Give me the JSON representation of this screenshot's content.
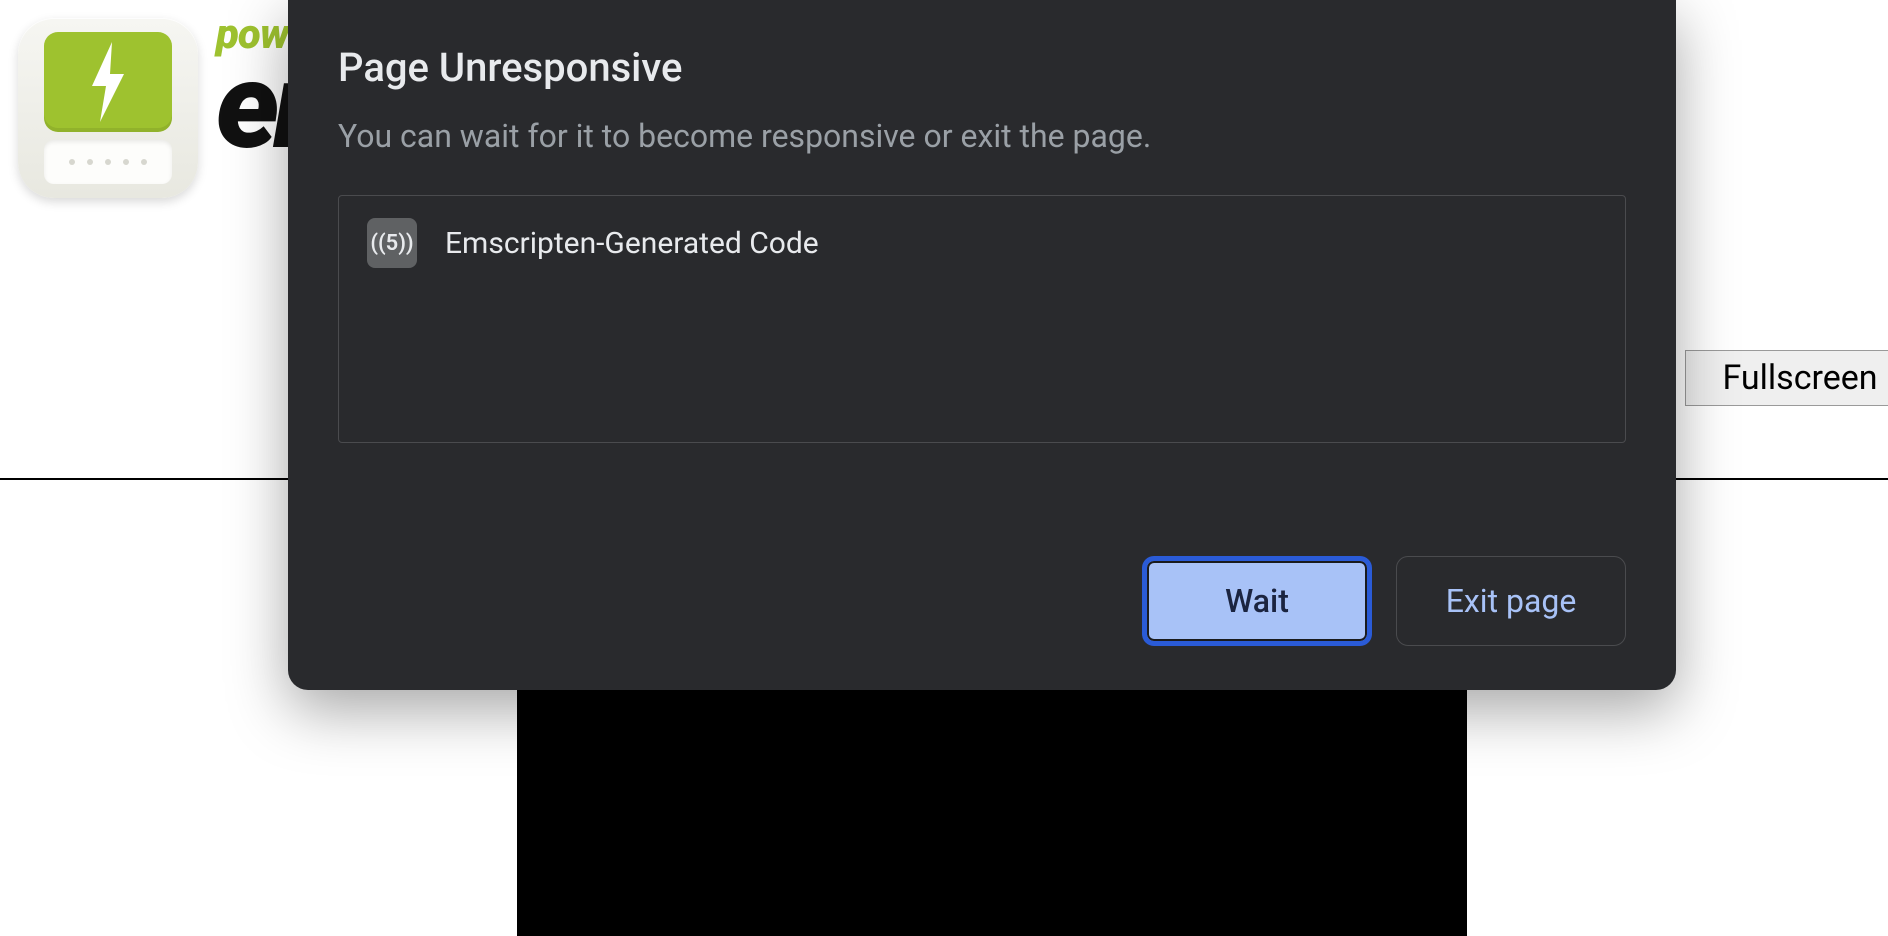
{
  "page": {
    "brand_powered": "powered by",
    "brand_name_fragment": "em",
    "fullscreen_label": "Fullscreen"
  },
  "dialog": {
    "title": "Page Unresponsive",
    "subtitle": "You can wait for it to become responsive or exit the page.",
    "items": [
      {
        "icon_text": "((5))",
        "label": "Emscripten-Generated Code"
      }
    ],
    "wait_label": "Wait",
    "exit_label": "Exit page"
  }
}
